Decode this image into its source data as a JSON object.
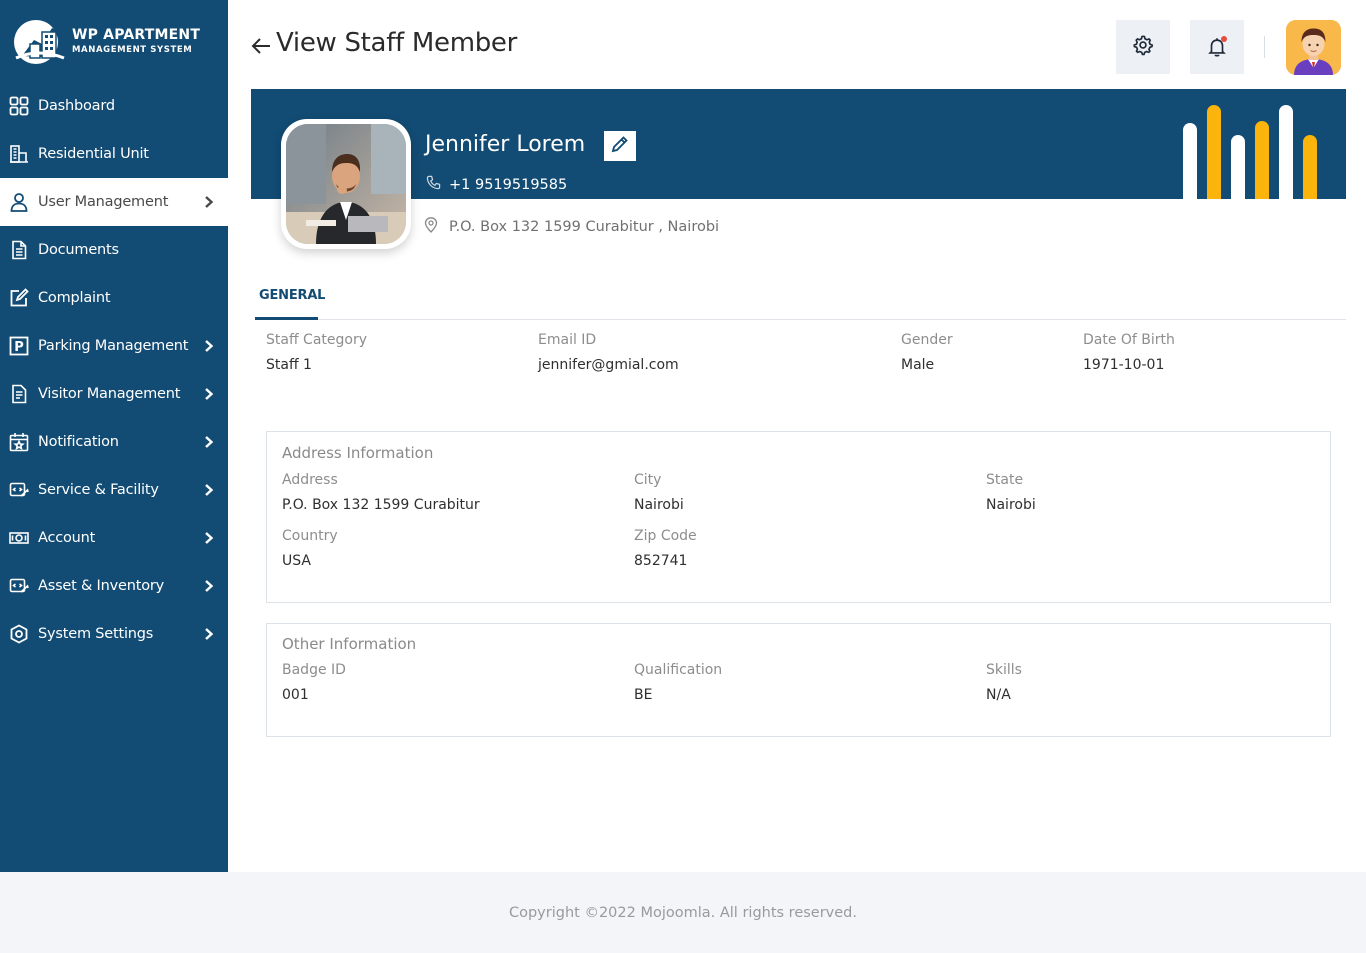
{
  "brand": {
    "title": "WP APARTMENT",
    "subtitle": "MANAGEMENT SYSTEM"
  },
  "sidebar": {
    "items": [
      {
        "label": "Dashboard",
        "icon": "grid-icon",
        "chevron": false,
        "active": false
      },
      {
        "label": "Residential Unit",
        "icon": "building-icon",
        "chevron": false,
        "active": false
      },
      {
        "label": "User Management",
        "icon": "user-icon",
        "chevron": true,
        "active": true
      },
      {
        "label": "Documents",
        "icon": "document-icon",
        "chevron": false,
        "active": false
      },
      {
        "label": "Complaint",
        "icon": "edit-square-icon",
        "chevron": false,
        "active": false
      },
      {
        "label": "Parking Management",
        "icon": "parking-icon",
        "chevron": true,
        "active": false
      },
      {
        "label": "Visitor Management",
        "icon": "clipboard-icon",
        "chevron": true,
        "active": false
      },
      {
        "label": "Notification",
        "icon": "calendar-star-icon",
        "chevron": true,
        "active": false
      },
      {
        "label": "Service & Facility",
        "icon": "service-icon",
        "chevron": true,
        "active": false
      },
      {
        "label": "Account",
        "icon": "money-icon",
        "chevron": true,
        "active": false
      },
      {
        "label": "Asset & Inventory",
        "icon": "asset-icon",
        "chevron": true,
        "active": false
      },
      {
        "label": "System Settings",
        "icon": "settings-eye-icon",
        "chevron": true,
        "active": false
      }
    ]
  },
  "header": {
    "title": "View Staff Member",
    "settings_icon": "gear-icon",
    "notification_icon": "bell-icon",
    "notification_dot_color": "#e74c3c"
  },
  "profile": {
    "name": "Jennifer Lorem",
    "phone": "+1  9519519585",
    "address": "P.O. Box 132 1599 Curabitur , Nairobi"
  },
  "tabs": [
    {
      "label": "GENERAL",
      "active": true
    }
  ],
  "general": {
    "staff_category": {
      "label": "Staff Category",
      "value": "Staff 1"
    },
    "email": {
      "label": "Email ID",
      "value": "jennifer@gmial.com"
    },
    "gender": {
      "label": "Gender",
      "value": "Male"
    },
    "dob": {
      "label": "Date Of Birth",
      "value": "1971-10-01"
    }
  },
  "address_info": {
    "title": "Address Information",
    "address": {
      "label": "Address",
      "value": "P.O. Box 132 1599 Curabitur"
    },
    "city": {
      "label": "City",
      "value": "Nairobi"
    },
    "state": {
      "label": "State",
      "value": "Nairobi"
    },
    "country": {
      "label": "Country",
      "value": "USA"
    },
    "zip": {
      "label": "Zip Code",
      "value": "852741"
    }
  },
  "other_info": {
    "title": "Other Information",
    "badge": {
      "label": "Badge ID",
      "value": "001"
    },
    "qualification": {
      "label": "Qualification",
      "value": "BE"
    },
    "skills": {
      "label": "Skills",
      "value": "N/A"
    }
  },
  "footer": {
    "text": "Copyright ©2022 Mojoomla. All rights reserved."
  },
  "colors": {
    "primary": "#124b73",
    "accent": "#fbb40b",
    "footer_bg": "#f3f5f9"
  }
}
